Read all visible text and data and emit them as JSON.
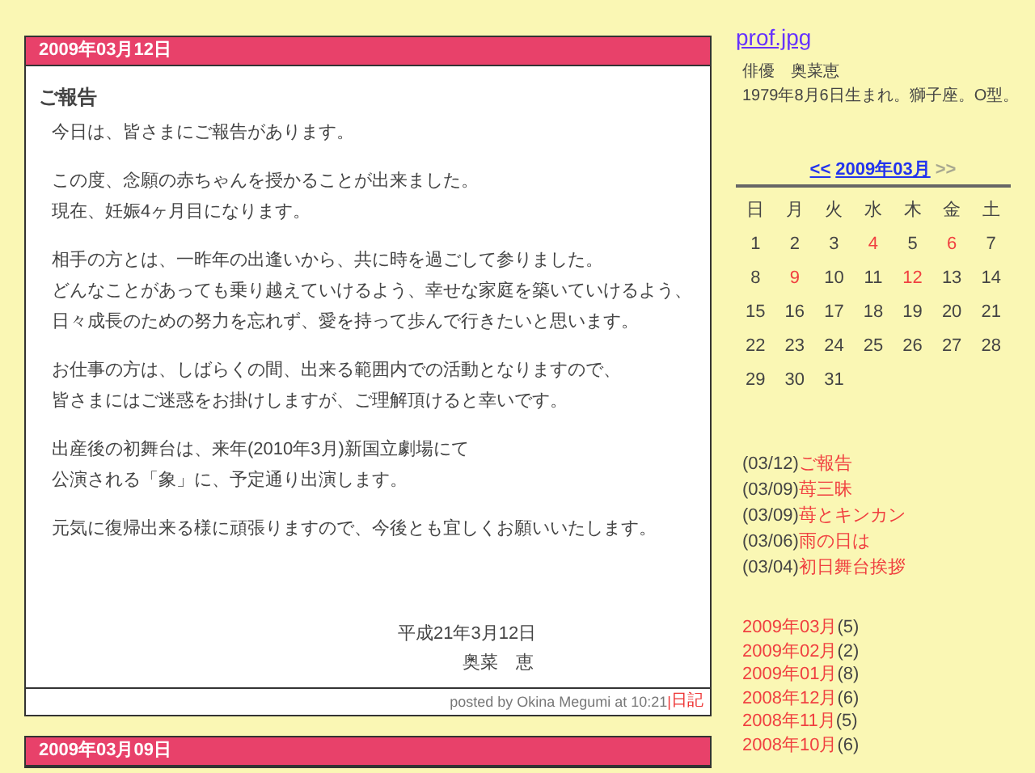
{
  "posts": [
    {
      "date": "2009年03月12日",
      "title": "ご報告",
      "paragraphs": [
        [
          "今日は、皆さまにご報告があります。"
        ],
        [
          "この度、念願の赤ちゃんを授かることが出来ました。",
          "現在、妊娠4ヶ月目になります。"
        ],
        [
          "相手の方とは、一昨年の出逢いから、共に時を過ごして参りました。",
          "どんなことがあっても乗り越えていけるよう、幸せな家庭を築いていけるよう、",
          "日々成長のための努力を忘れず、愛を持って歩んで行きたいと思います。"
        ],
        [
          "お仕事の方は、しばらくの間、出来る範囲内での活動となりますので、",
          "皆さまにはご迷惑をお掛けしますが、ご理解頂けると幸いです。"
        ],
        [
          "出産後の初舞台は、来年(2010年3月)新国立劇場にて",
          "公演される「象」に、予定通り出演します。"
        ],
        [
          "元気に復帰出来る様に頑張りますので、今後とも宜しくお願いいたします。"
        ]
      ],
      "signature": [
        "平成21年3月12日",
        "奥菜　恵"
      ],
      "footer": "posted by Okina Megumi at 10:21",
      "separator": "|",
      "category": "日記"
    },
    {
      "date": "2009年03月09日"
    }
  ],
  "sidebar": {
    "profile_link": "prof.jpg",
    "profile_lines": [
      "俳優　奥菜恵",
      "1979年8月6日生まれ。獅子座。O型。"
    ],
    "calendar": {
      "prev": "<<",
      "month": "2009年03月",
      "next": ">>",
      "next_disabled": true,
      "weekdays": [
        "日",
        "月",
        "火",
        "水",
        "木",
        "金",
        "土"
      ],
      "weeks": [
        [
          {
            "day": "1",
            "linked": false
          },
          {
            "day": "2",
            "linked": false
          },
          {
            "day": "3",
            "linked": false
          },
          {
            "day": "4",
            "linked": true
          },
          {
            "day": "5",
            "linked": false
          },
          {
            "day": "6",
            "linked": true
          },
          {
            "day": "7",
            "linked": false
          }
        ],
        [
          {
            "day": "8",
            "linked": false
          },
          {
            "day": "9",
            "linked": true
          },
          {
            "day": "10",
            "linked": false
          },
          {
            "day": "11",
            "linked": false
          },
          {
            "day": "12",
            "linked": true
          },
          {
            "day": "13",
            "linked": false
          },
          {
            "day": "14",
            "linked": false
          }
        ],
        [
          {
            "day": "15",
            "linked": false
          },
          {
            "day": "16",
            "linked": false
          },
          {
            "day": "17",
            "linked": false
          },
          {
            "day": "18",
            "linked": false
          },
          {
            "day": "19",
            "linked": false
          },
          {
            "day": "20",
            "linked": false
          },
          {
            "day": "21",
            "linked": false
          }
        ],
        [
          {
            "day": "22",
            "linked": false
          },
          {
            "day": "23",
            "linked": false
          },
          {
            "day": "24",
            "linked": false
          },
          {
            "day": "25",
            "linked": false
          },
          {
            "day": "26",
            "linked": false
          },
          {
            "day": "27",
            "linked": false
          },
          {
            "day": "28",
            "linked": false
          }
        ],
        [
          {
            "day": "29",
            "linked": false
          },
          {
            "day": "30",
            "linked": false
          },
          {
            "day": "31",
            "linked": false
          }
        ]
      ]
    },
    "recent_entries": [
      {
        "date": "(03/12)",
        "title": "ご報告"
      },
      {
        "date": "(03/09)",
        "title": "苺三昧"
      },
      {
        "date": "(03/09)",
        "title": "苺とキンカン"
      },
      {
        "date": "(03/06)",
        "title": "雨の日は"
      },
      {
        "date": "(03/04)",
        "title": "初日舞台挨拶"
      }
    ],
    "archives": [
      {
        "month": "2009年03月",
        "count": "(5)"
      },
      {
        "month": "2009年02月",
        "count": "(2)"
      },
      {
        "month": "2009年01月",
        "count": "(8)"
      },
      {
        "month": "2008年12月",
        "count": "(6)"
      },
      {
        "month": "2008年11月",
        "count": "(5)"
      },
      {
        "month": "2008年10月",
        "count": "(6)"
      }
    ]
  }
}
